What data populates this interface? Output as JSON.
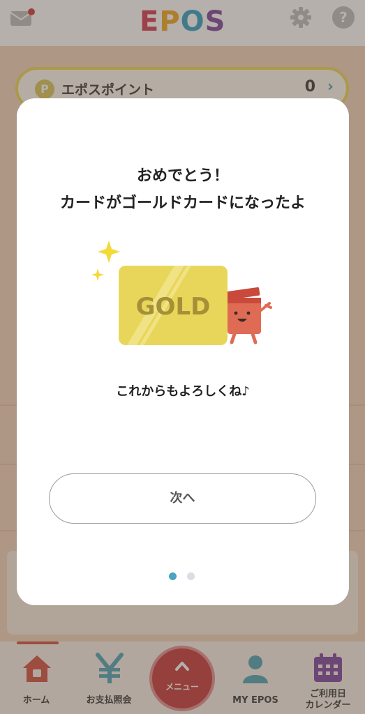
{
  "header": {
    "logo_letters": [
      "E",
      "P",
      "O",
      "S"
    ],
    "logo_colors": [
      "#d6334b",
      "#f0a418",
      "#2c9ec3",
      "#7b3f9a"
    ],
    "mail_icon": "mail-icon",
    "settings_icon": "gear-icon",
    "help_icon": "question-icon"
  },
  "points": {
    "label": "エポスポイント",
    "badge": "P",
    "value": "0",
    "chevron": "›"
  },
  "modal": {
    "title_line1": "おめでとう！",
    "title_line2": "カードがゴールドカードになったよ",
    "card_text": "GOLD",
    "message": "これからもよろしくね♪",
    "next_label": "次へ",
    "page_indicator": {
      "current": 1,
      "total": 2
    },
    "dot_active_color": "#4aa3c0",
    "dot_inactive_color": "#dcdce4"
  },
  "bottom_nav": {
    "items": [
      {
        "label": "ホーム",
        "icon": "home-icon",
        "active": true
      },
      {
        "label": "お支払照会",
        "icon": "yen-icon",
        "active": false
      },
      {
        "label": "メニュー",
        "icon": "chevron-up-icon",
        "active": false
      },
      {
        "label": "MY EPOS",
        "icon": "person-icon",
        "active": false
      },
      {
        "label_line1": "ご利用日",
        "label_line2": "カレンダー",
        "icon": "calendar-icon",
        "active": false
      }
    ]
  },
  "colors": {
    "accent_red": "#c53434",
    "gold": "#e8d65a",
    "teal": "#4a9bb0"
  }
}
